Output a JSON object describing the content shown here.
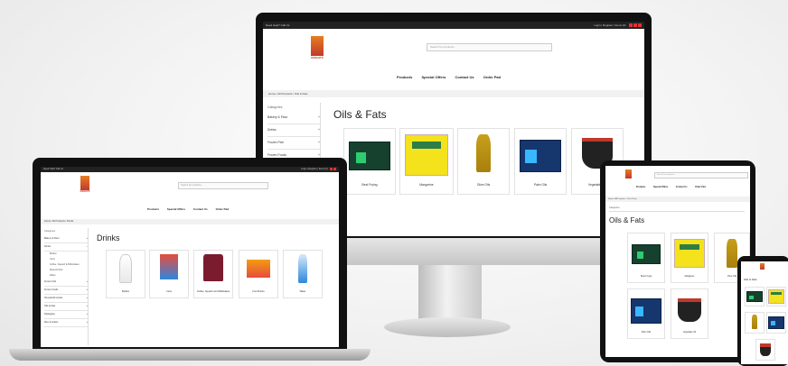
{
  "brand": {
    "logo_text": "KNIGHTS",
    "accent": "#d33a2c"
  },
  "topbar": {
    "left": "Need Help? Call Us",
    "right": "Login | Register | Items (0)"
  },
  "search": {
    "placeholder": "Search for products..."
  },
  "nav": [
    "Products",
    "Special Offers",
    "Contact Us",
    "Order Pad"
  ],
  "categories_heading": "Categories",
  "desktop": {
    "breadcrumb": "Home / All Products / Oils & Fats",
    "sidebar": [
      "Bakery & Flour",
      "Drinks",
      "Frozen Fish",
      "Frozen Foods"
    ],
    "title": "Oils & Fats",
    "products": [
      "Best Frying",
      "Margarine",
      "Olive Oils",
      "Palm Oils",
      "Vegetable Oil"
    ]
  },
  "laptop": {
    "breadcrumb": "Home / All Products / Drinks",
    "sidebar_top": [
      "Bakery & Flour",
      "Drinks"
    ],
    "sidebar_sub": [
      "Bottles",
      "Cans",
      "Coffee, Squash & Milkshakes",
      "Mixed Drinks",
      "Water"
    ],
    "sidebar_bottom": [
      "Frozen Fish",
      "Frozen Foods",
      "Household Goods",
      "Oils & Fats",
      "Packaging",
      "Rice & Grains"
    ],
    "title": "Drinks",
    "products": [
      "Bottles",
      "Cans",
      "Coffee, Squash and Milkshakes",
      "Fruit Drinks",
      "Water"
    ]
  },
  "tablet": {
    "breadcrumb": "Home / All Products / Oils & Fats",
    "title": "Oils & Fats",
    "products": [
      "Best Frying",
      "Margarine",
      "Olive Oils",
      "Palm Oils",
      "Vegetable Oil"
    ]
  },
  "phone": {
    "title": "Oils & Fats",
    "products": [
      "Best Frying",
      "Margarine",
      "Olive Oils",
      "Palm Oils",
      "Vegetable Oil"
    ]
  }
}
